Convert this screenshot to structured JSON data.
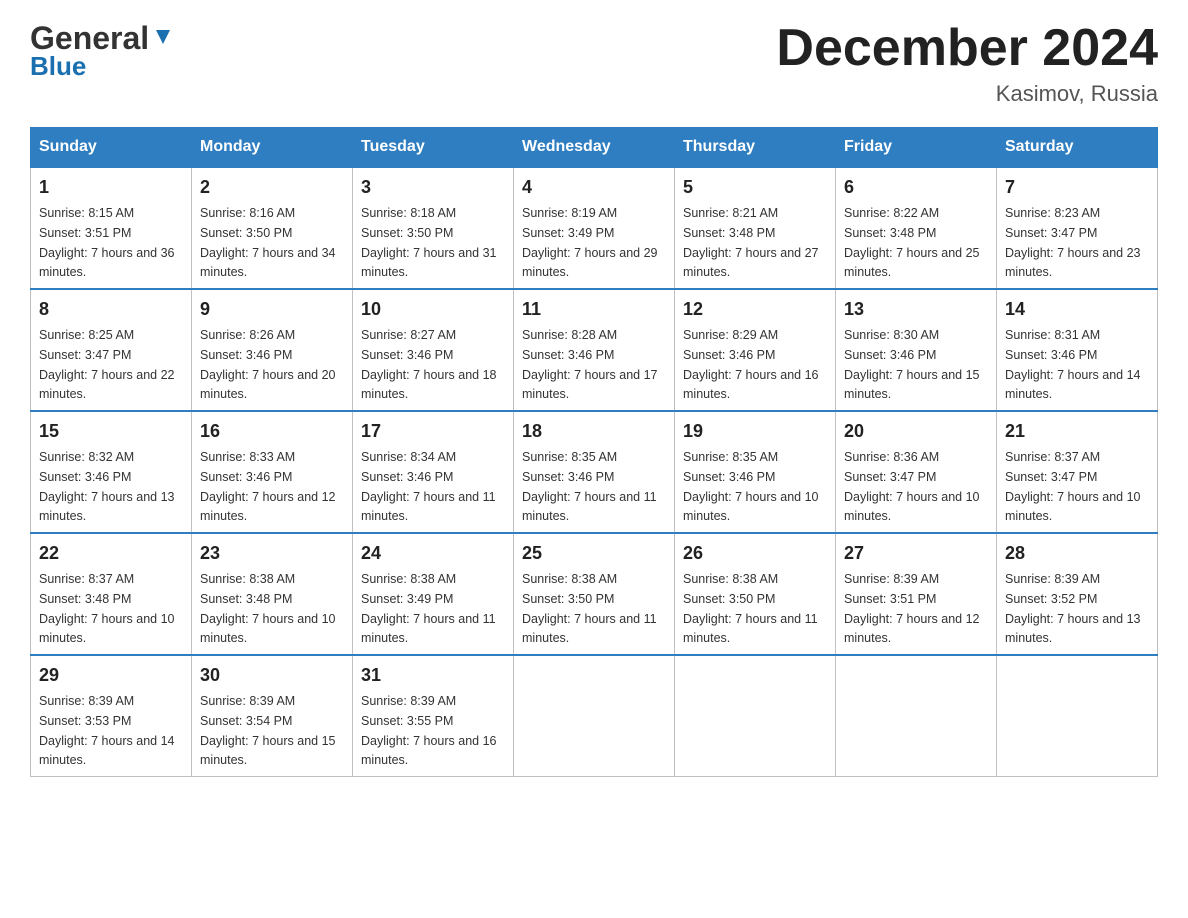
{
  "header": {
    "logo_general": "General",
    "logo_blue": "Blue",
    "title": "December 2024",
    "subtitle": "Kasimov, Russia"
  },
  "calendar": {
    "days_of_week": [
      "Sunday",
      "Monday",
      "Tuesday",
      "Wednesday",
      "Thursday",
      "Friday",
      "Saturday"
    ],
    "weeks": [
      [
        {
          "day": "1",
          "sunrise": "8:15 AM",
          "sunset": "3:51 PM",
          "daylight": "7 hours and 36 minutes."
        },
        {
          "day": "2",
          "sunrise": "8:16 AM",
          "sunset": "3:50 PM",
          "daylight": "7 hours and 34 minutes."
        },
        {
          "day": "3",
          "sunrise": "8:18 AM",
          "sunset": "3:50 PM",
          "daylight": "7 hours and 31 minutes."
        },
        {
          "day": "4",
          "sunrise": "8:19 AM",
          "sunset": "3:49 PM",
          "daylight": "7 hours and 29 minutes."
        },
        {
          "day": "5",
          "sunrise": "8:21 AM",
          "sunset": "3:48 PM",
          "daylight": "7 hours and 27 minutes."
        },
        {
          "day": "6",
          "sunrise": "8:22 AM",
          "sunset": "3:48 PM",
          "daylight": "7 hours and 25 minutes."
        },
        {
          "day": "7",
          "sunrise": "8:23 AM",
          "sunset": "3:47 PM",
          "daylight": "7 hours and 23 minutes."
        }
      ],
      [
        {
          "day": "8",
          "sunrise": "8:25 AM",
          "sunset": "3:47 PM",
          "daylight": "7 hours and 22 minutes."
        },
        {
          "day": "9",
          "sunrise": "8:26 AM",
          "sunset": "3:46 PM",
          "daylight": "7 hours and 20 minutes."
        },
        {
          "day": "10",
          "sunrise": "8:27 AM",
          "sunset": "3:46 PM",
          "daylight": "7 hours and 18 minutes."
        },
        {
          "day": "11",
          "sunrise": "8:28 AM",
          "sunset": "3:46 PM",
          "daylight": "7 hours and 17 minutes."
        },
        {
          "day": "12",
          "sunrise": "8:29 AM",
          "sunset": "3:46 PM",
          "daylight": "7 hours and 16 minutes."
        },
        {
          "day": "13",
          "sunrise": "8:30 AM",
          "sunset": "3:46 PM",
          "daylight": "7 hours and 15 minutes."
        },
        {
          "day": "14",
          "sunrise": "8:31 AM",
          "sunset": "3:46 PM",
          "daylight": "7 hours and 14 minutes."
        }
      ],
      [
        {
          "day": "15",
          "sunrise": "8:32 AM",
          "sunset": "3:46 PM",
          "daylight": "7 hours and 13 minutes."
        },
        {
          "day": "16",
          "sunrise": "8:33 AM",
          "sunset": "3:46 PM",
          "daylight": "7 hours and 12 minutes."
        },
        {
          "day": "17",
          "sunrise": "8:34 AM",
          "sunset": "3:46 PM",
          "daylight": "7 hours and 11 minutes."
        },
        {
          "day": "18",
          "sunrise": "8:35 AM",
          "sunset": "3:46 PM",
          "daylight": "7 hours and 11 minutes."
        },
        {
          "day": "19",
          "sunrise": "8:35 AM",
          "sunset": "3:46 PM",
          "daylight": "7 hours and 10 minutes."
        },
        {
          "day": "20",
          "sunrise": "8:36 AM",
          "sunset": "3:47 PM",
          "daylight": "7 hours and 10 minutes."
        },
        {
          "day": "21",
          "sunrise": "8:37 AM",
          "sunset": "3:47 PM",
          "daylight": "7 hours and 10 minutes."
        }
      ],
      [
        {
          "day": "22",
          "sunrise": "8:37 AM",
          "sunset": "3:48 PM",
          "daylight": "7 hours and 10 minutes."
        },
        {
          "day": "23",
          "sunrise": "8:38 AM",
          "sunset": "3:48 PM",
          "daylight": "7 hours and 10 minutes."
        },
        {
          "day": "24",
          "sunrise": "8:38 AM",
          "sunset": "3:49 PM",
          "daylight": "7 hours and 11 minutes."
        },
        {
          "day": "25",
          "sunrise": "8:38 AM",
          "sunset": "3:50 PM",
          "daylight": "7 hours and 11 minutes."
        },
        {
          "day": "26",
          "sunrise": "8:38 AM",
          "sunset": "3:50 PM",
          "daylight": "7 hours and 11 minutes."
        },
        {
          "day": "27",
          "sunrise": "8:39 AM",
          "sunset": "3:51 PM",
          "daylight": "7 hours and 12 minutes."
        },
        {
          "day": "28",
          "sunrise": "8:39 AM",
          "sunset": "3:52 PM",
          "daylight": "7 hours and 13 minutes."
        }
      ],
      [
        {
          "day": "29",
          "sunrise": "8:39 AM",
          "sunset": "3:53 PM",
          "daylight": "7 hours and 14 minutes."
        },
        {
          "day": "30",
          "sunrise": "8:39 AM",
          "sunset": "3:54 PM",
          "daylight": "7 hours and 15 minutes."
        },
        {
          "day": "31",
          "sunrise": "8:39 AM",
          "sunset": "3:55 PM",
          "daylight": "7 hours and 16 minutes."
        },
        null,
        null,
        null,
        null
      ]
    ]
  }
}
